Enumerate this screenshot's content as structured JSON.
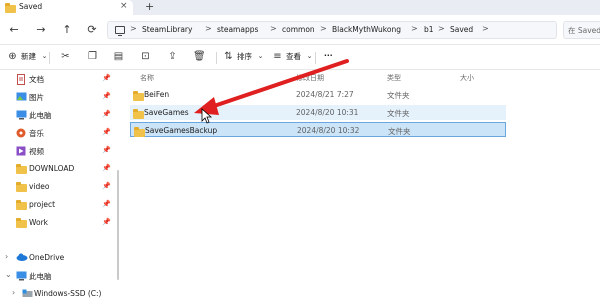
{
  "tab": {
    "title": "Saved",
    "close": "×",
    "new_tab": "+"
  },
  "nav": {
    "back": "←",
    "forward": "→",
    "up": "↑",
    "refresh": "⟳"
  },
  "breadcrumb": {
    "sep": ">",
    "more": "...",
    "items": [
      "SteamLibrary",
      "steamapps",
      "common",
      "BlackMythWukong",
      "b1",
      "Saved"
    ]
  },
  "search": {
    "placeholder": "在 Saved 中搜索"
  },
  "toolbar": {
    "new_label": "新建",
    "sort_label": "排序",
    "view_label": "查看",
    "more_label": "···"
  },
  "sidebar": {
    "items": [
      {
        "label": "文档",
        "icon": "document-icon",
        "pinned": true
      },
      {
        "label": "图片",
        "icon": "pictures-icon",
        "pinned": true
      },
      {
        "label": "此电脑",
        "icon": "monitor-icon",
        "pinned": true
      },
      {
        "label": "音乐",
        "icon": "music-icon",
        "pinned": true
      },
      {
        "label": "视频",
        "icon": "video-icon",
        "pinned": true
      },
      {
        "label": "DOWNLOAD",
        "icon": "folder-icon",
        "pinned": true
      },
      {
        "label": "video",
        "icon": "folder-icon",
        "pinned": true
      },
      {
        "label": "project",
        "icon": "folder-icon",
        "pinned": true
      },
      {
        "label": "Work",
        "icon": "folder-icon",
        "pinned": true
      }
    ],
    "onedrive": "OneDrive",
    "this_pc": "此电脑",
    "drive": "Windows-SSD (C:)"
  },
  "columns": {
    "name": "名称",
    "date": "修改日期",
    "type": "类型",
    "size": "大小"
  },
  "files": [
    {
      "name": "BeiFen",
      "date": "2024/8/21 7:27",
      "type": "文件夹"
    },
    {
      "name": "SaveGames",
      "date": "2024/8/20 10:31",
      "type": "文件夹"
    },
    {
      "name": "SaveGamesBackup",
      "date": "2024/8/20 10:32",
      "type": "文件夹"
    }
  ],
  "colors": {
    "folder": "#f0c24a",
    "selection": "#cce4f7",
    "hover": "#e5f1fb",
    "annotation_arrow": "#e02020"
  }
}
